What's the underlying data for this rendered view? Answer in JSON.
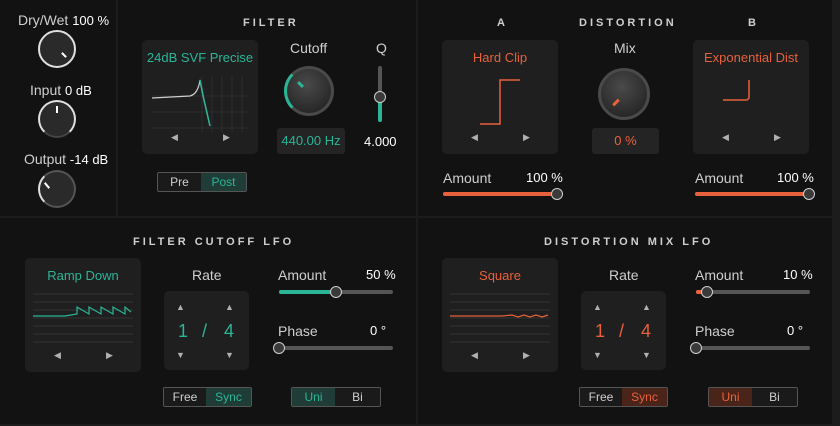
{
  "colors": {
    "teal": "#2bb597",
    "orange": "#e8613c",
    "panel": "#121212"
  },
  "mix": {
    "drywet_label": "Dry/Wet",
    "drywet_value": "100 %",
    "input_label": "Input",
    "input_value": "0 dB",
    "output_label": "Output",
    "output_value": "-14 dB"
  },
  "filter": {
    "title": "FILTER",
    "type": "24dB SVF Precise",
    "cutoff_label": "Cutoff",
    "cutoff_value": "440.00 Hz",
    "q_label": "Q",
    "q_value": "4.000",
    "pre_label": "Pre",
    "post_label": "Post",
    "selected": "Post"
  },
  "distortion": {
    "title": "DISTORTION",
    "a_label": "A",
    "b_label": "B",
    "a_type": "Hard Clip",
    "b_type": "Exponential Dist",
    "mix_label": "Mix",
    "mix_value": "0 %",
    "a_amount_label": "Amount",
    "a_amount_value": "100 %",
    "a_amount_level": 1.0,
    "b_amount_label": "Amount",
    "b_amount_value": "100 %",
    "b_amount_level": 1.0
  },
  "filter_lfo": {
    "title": "FILTER CUTOFF LFO",
    "shape": "Ramp Down",
    "rate_label": "Rate",
    "rate_num": "1",
    "rate_sep": "/",
    "rate_den": "4",
    "amount_label": "Amount",
    "amount_value": "50 %",
    "amount_level": 0.5,
    "phase_label": "Phase",
    "phase_value": "0 °",
    "phase_level": 0.0,
    "free_label": "Free",
    "sync_label": "Sync",
    "uni_label": "Uni",
    "bi_label": "Bi"
  },
  "dist_lfo": {
    "title": "DISTORTION MIX LFO",
    "shape": "Square",
    "rate_label": "Rate",
    "rate_num": "1",
    "rate_sep": "/",
    "rate_den": "4",
    "amount_label": "Amount",
    "amount_value": "10 %",
    "amount_level": 0.1,
    "phase_label": "Phase",
    "phase_value": "0 °",
    "phase_level": 0.0,
    "free_label": "Free",
    "sync_label": "Sync",
    "uni_label": "Uni",
    "bi_label": "Bi"
  },
  "icons": {
    "left_arrow": "◀",
    "right_arrow": "▶",
    "up_arrow": "▲",
    "down_arrow": "▼"
  }
}
